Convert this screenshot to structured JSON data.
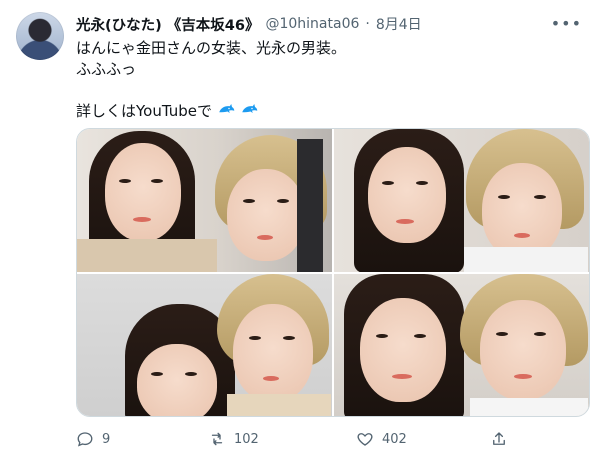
{
  "tweet": {
    "author_name": "光永(ひなた) 《吉本坂46》",
    "handle": "@10hinata06",
    "separator": "·",
    "date": "8月4日",
    "lines": [
      "はんにゃ金田さんの女装、光永の男装。",
      "ふふふっ",
      "",
      "詳しくはYouTubeで"
    ],
    "emoji": "dolphin-icon"
  },
  "actions": {
    "reply_count": "9",
    "retweet_count": "102",
    "like_count": "402"
  },
  "colors": {
    "text": "#0f1419",
    "secondary": "#536471",
    "border": "#cfd9de",
    "dolphin": "#1d9bf0"
  }
}
